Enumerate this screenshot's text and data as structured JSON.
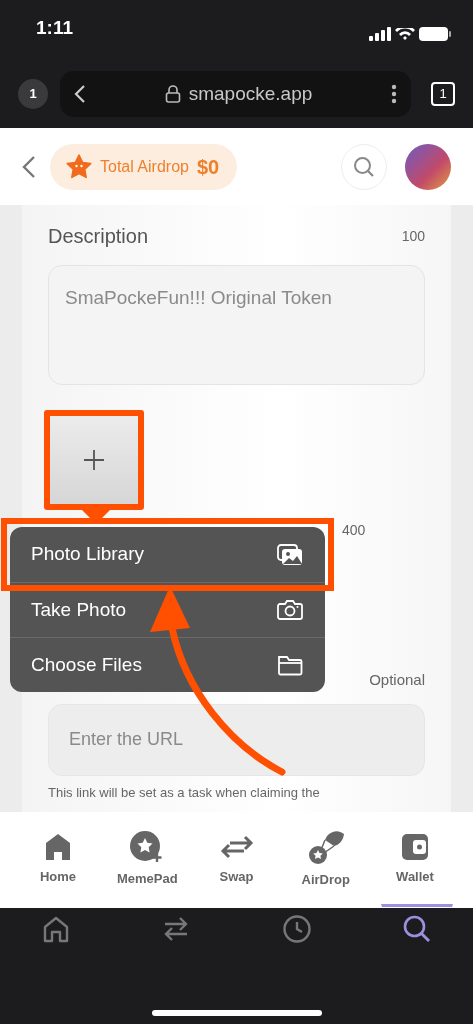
{
  "status_bar": {
    "time": "1:11"
  },
  "browser": {
    "tab_count": "1",
    "url": "smapocke.app",
    "tabs_button": "1"
  },
  "header": {
    "airdrop_label": "Total Airdrop",
    "airdrop_amount": "$0"
  },
  "form": {
    "description": {
      "label": "Description",
      "limit": "100",
      "value": "SmaPockeFun!!! Original Token"
    },
    "image_hint": "400",
    "url": {
      "note": "Optional",
      "placeholder": "Enter the URL",
      "help": "This link will be set as a task when claiming the"
    }
  },
  "picker_menu": {
    "items": [
      {
        "label": "Photo Library",
        "kind": "photos",
        "highlighted": true
      },
      {
        "label": "Take Photo",
        "kind": "camera",
        "highlighted": false
      },
      {
        "label": "Choose Files",
        "kind": "folder",
        "highlighted": false
      }
    ]
  },
  "bottom_nav": {
    "items": [
      {
        "label": "Home",
        "kind": "home"
      },
      {
        "label": "MemePad",
        "kind": "memepad"
      },
      {
        "label": "Swap",
        "kind": "swap"
      },
      {
        "label": "AirDrop",
        "kind": "airdrop"
      },
      {
        "label": "Wallet",
        "kind": "wallet"
      }
    ]
  },
  "browser_toolbar": {
    "items": [
      {
        "kind": "home",
        "selected": false
      },
      {
        "kind": "swap",
        "selected": false
      },
      {
        "kind": "history",
        "selected": false
      },
      {
        "kind": "search",
        "selected": true
      }
    ]
  }
}
